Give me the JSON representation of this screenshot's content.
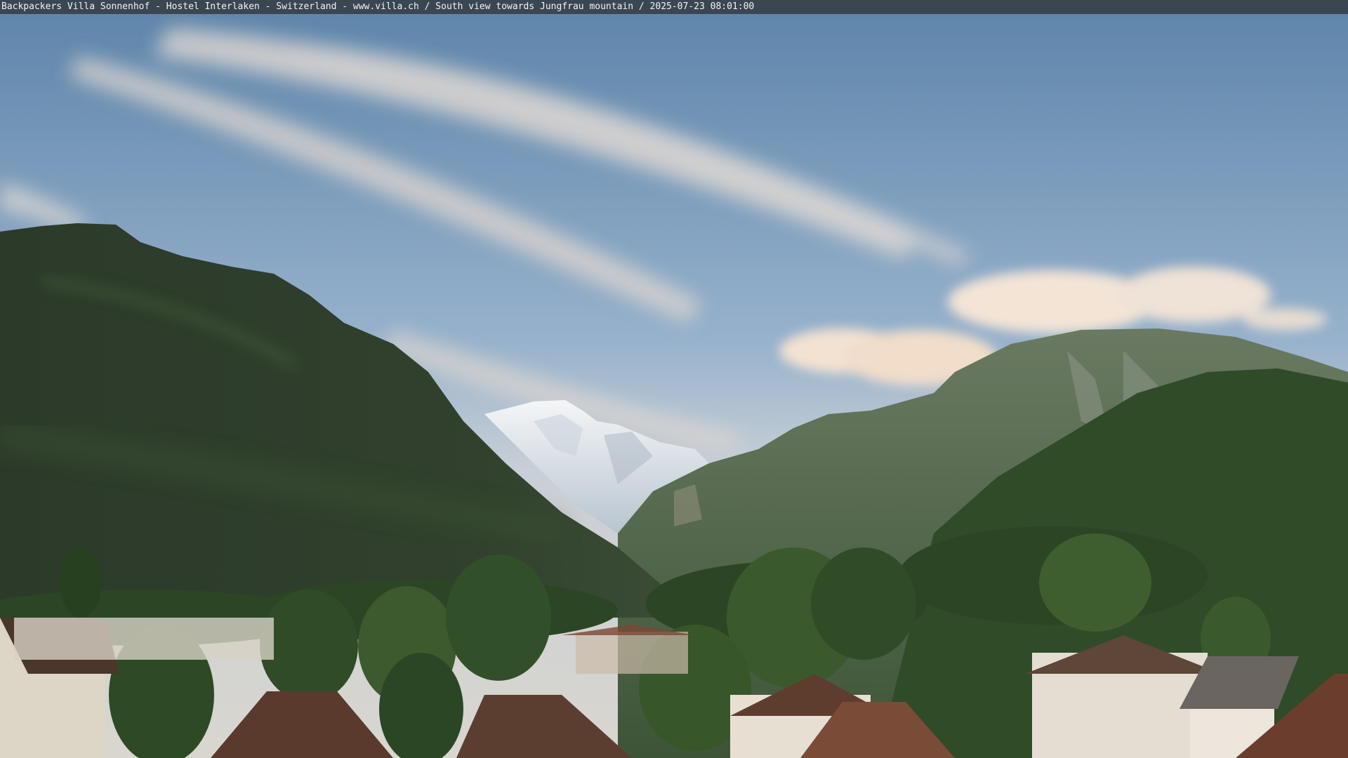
{
  "caption": {
    "text": "Backpackers Villa Sonnenhof - Hostel Interlaken - Switzerland - www.villa.ch / South view towards Jungfrau mountain / 2025-07-23 08:01:00"
  },
  "scene": {
    "colors": {
      "sky_top": "#5f86ab",
      "sky_mid": "#9db6cf",
      "sky_low": "#c9cfd6",
      "cloud_warm": "#f1dfcf",
      "left_mountain": "#2b3a2a",
      "right_mountain": "#4f6448",
      "snow_peak": "#e8edf2",
      "forest": "#2f4a26",
      "roof": "#6e3d2c",
      "wall": "#ece4d6"
    }
  }
}
